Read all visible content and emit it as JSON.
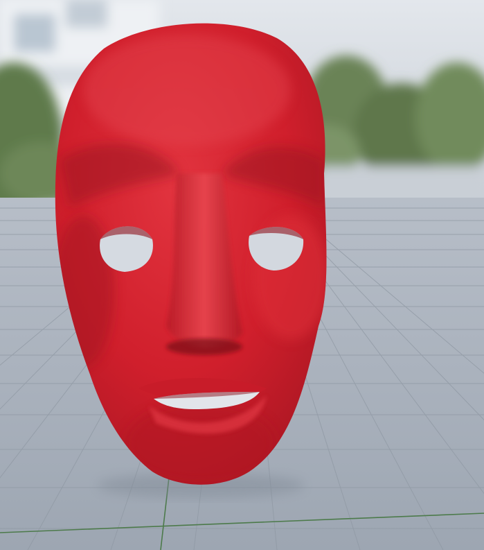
{
  "scene": {
    "subject": "red-face-mask",
    "colors": {
      "sky": "#d7dde4",
      "foliage": "#6f8a5a",
      "building": "#e9ecef",
      "floor": "#a9b1bc",
      "grid_line": "#8f98a3",
      "axis_line": "#4c7a4a",
      "mask_base": "#d5202e",
      "mask_shadow": "#9d1420",
      "mask_highlight": "#e9555d"
    }
  }
}
